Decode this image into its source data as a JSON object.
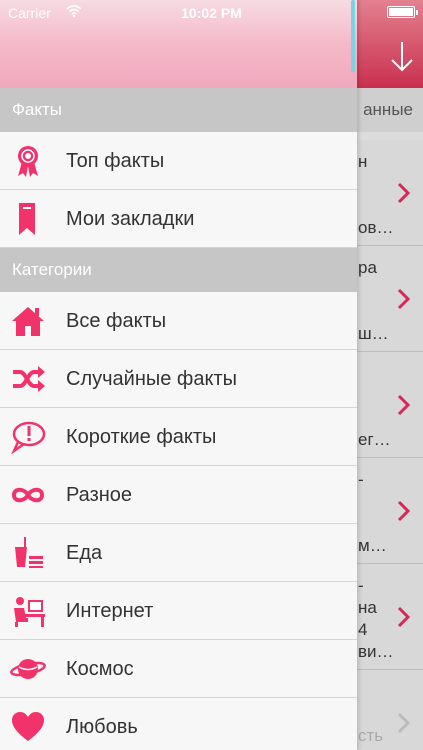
{
  "status": {
    "carrier": "Carrier",
    "time": "10:02 PM"
  },
  "accent_color": "#f2336b",
  "main": {
    "tab_fragment": "анные",
    "fragments": [
      "н",
      "ов…",
      "ра",
      "ш…",
      "ег…",
      "-",
      "м…",
      "-",
      "на",
      "4",
      "ви…",
      "сть"
    ]
  },
  "drawer": {
    "sections": [
      {
        "title": "Факты",
        "items": [
          {
            "label": "Топ факты",
            "icon": "ribbon-medal-icon"
          },
          {
            "label": "Мои закладки",
            "icon": "bookmark-icon"
          }
        ]
      },
      {
        "title": "Категории",
        "items": [
          {
            "label": "Все факты",
            "icon": "home-icon"
          },
          {
            "label": "Случайные факты",
            "icon": "shuffle-icon"
          },
          {
            "label": "Короткие факты",
            "icon": "speech-bubble-exclamation-icon"
          },
          {
            "label": "Разное",
            "icon": "infinity-icon"
          },
          {
            "label": "Еда",
            "icon": "drink-food-icon"
          },
          {
            "label": "Интернет",
            "icon": "computer-user-icon"
          },
          {
            "label": "Космос",
            "icon": "planet-icon"
          },
          {
            "label": "Любовь",
            "icon": "heart-icon"
          }
        ]
      }
    ]
  }
}
